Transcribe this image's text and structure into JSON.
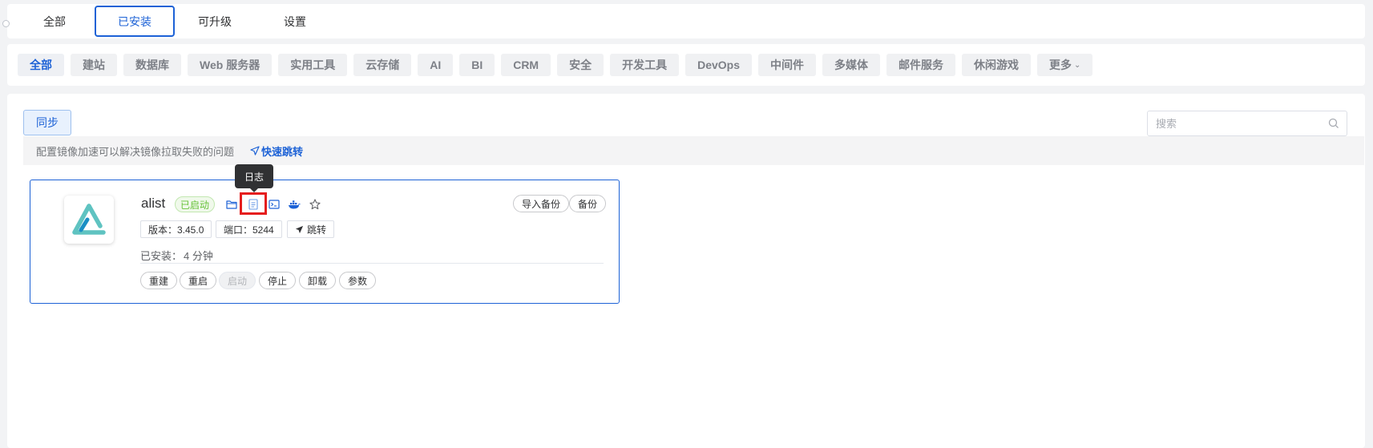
{
  "tabs": [
    {
      "label": "全部",
      "active": false
    },
    {
      "label": "已安装",
      "active": true
    },
    {
      "label": "可升级",
      "active": false
    },
    {
      "label": "设置",
      "active": false
    }
  ],
  "categories": [
    {
      "label": "全部",
      "active": true
    },
    {
      "label": "建站"
    },
    {
      "label": "数据库"
    },
    {
      "label": "Web 服务器"
    },
    {
      "label": "实用工具"
    },
    {
      "label": "云存储"
    },
    {
      "label": "AI"
    },
    {
      "label": "BI"
    },
    {
      "label": "CRM"
    },
    {
      "label": "安全"
    },
    {
      "label": "开发工具"
    },
    {
      "label": "DevOps"
    },
    {
      "label": "中间件"
    },
    {
      "label": "多媒体"
    },
    {
      "label": "邮件服务"
    },
    {
      "label": "休闲游戏"
    },
    {
      "label": "更多",
      "has_dropdown": true
    }
  ],
  "toolbar": {
    "sync_label": "同步",
    "search_placeholder": "搜索"
  },
  "notice": {
    "text": "配置镜像加速可以解决镜像拉取失败的问题",
    "link_label": "快速跳转"
  },
  "app": {
    "name": "alist",
    "status": "已启动",
    "tooltip": "日志",
    "icons": [
      "folder-icon",
      "log-icon",
      "terminal-icon",
      "docker-icon",
      "star-icon"
    ],
    "import_backup_label": "导入备份",
    "backup_label": "备份",
    "version_tag": "版本：3.45.0",
    "port_tag": "端口：5244",
    "jump_label": "跳转",
    "installed_label": "已安装：",
    "installed_value": "4 分钟",
    "actions": {
      "rebuild": "重建",
      "restart": "重启",
      "start": "启动",
      "stop": "停止",
      "uninstall": "卸载",
      "params": "参数"
    },
    "colors": {
      "accent": "#1d62d6",
      "status_green": "#67c23a",
      "logo_teal": "#5fc3c1",
      "highlight_red": "#e51d1d"
    }
  }
}
